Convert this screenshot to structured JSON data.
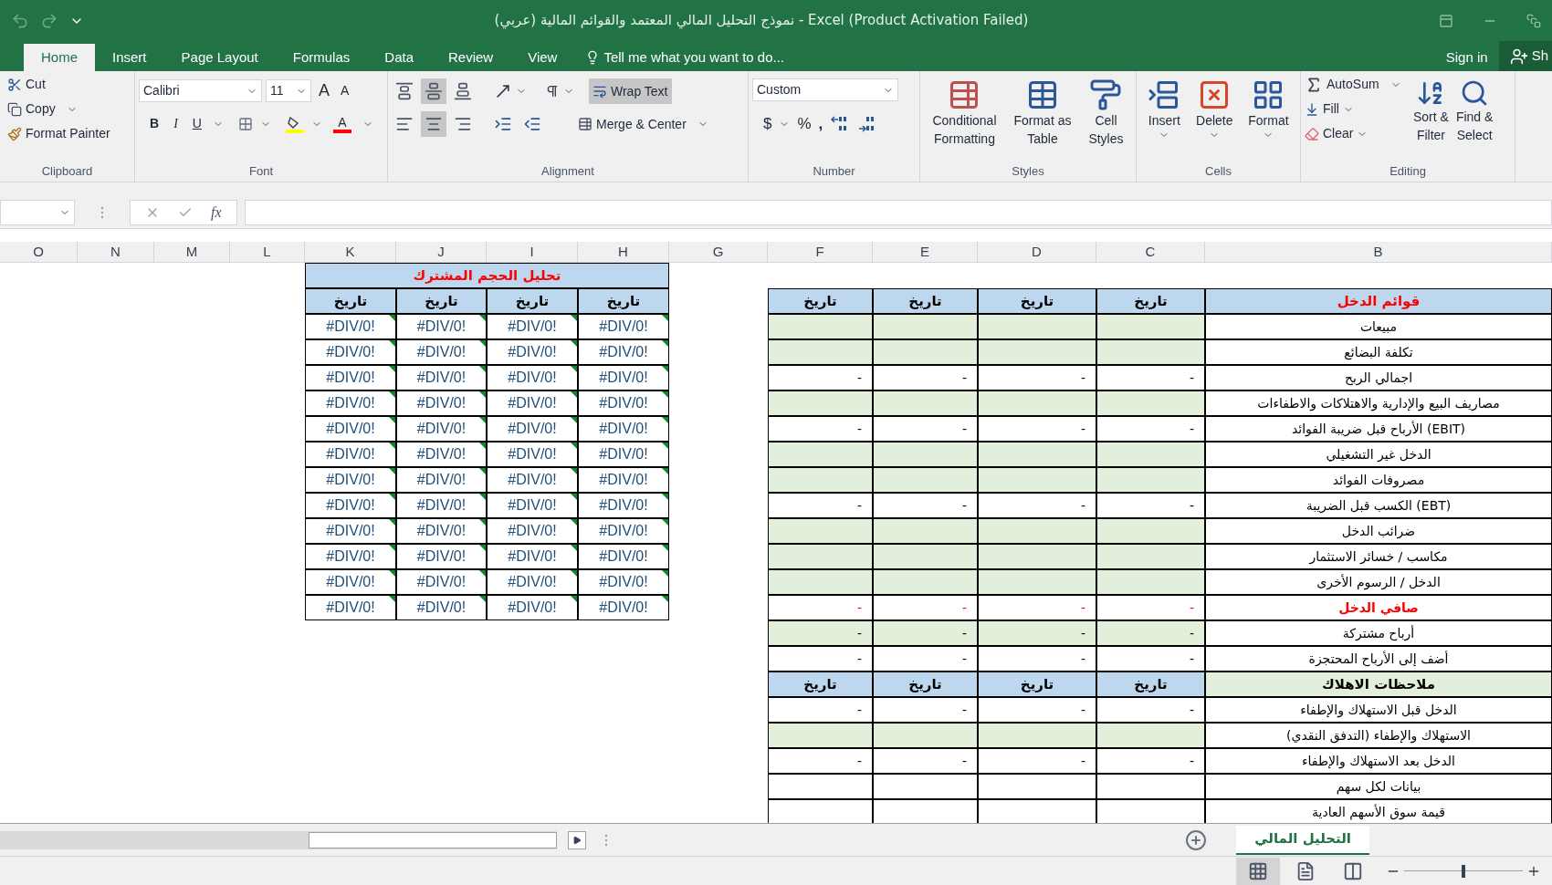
{
  "title_bar": {
    "title": "نموذج التحليل المالي المعتمد والقوائم المالية (عربي) - Excel (Product Activation Failed)"
  },
  "ribbon_tabs": [
    {
      "label": "Home",
      "selected": true
    },
    {
      "label": "Insert",
      "selected": false
    },
    {
      "label": "Page Layout",
      "selected": false
    },
    {
      "label": "Formulas",
      "selected": false
    },
    {
      "label": "Data",
      "selected": false
    },
    {
      "label": "Review",
      "selected": false
    },
    {
      "label": "View",
      "selected": false
    }
  ],
  "tell_me": "Tell me what you want to do...",
  "sign_in": "Sign in",
  "share": "Sh",
  "ribbon": {
    "clipboard": {
      "label": "Clipboard",
      "cut": "Cut",
      "copy": "Copy",
      "format_painter": "Format Painter"
    },
    "font": {
      "label": "Font",
      "font_name": "Calibri",
      "font_size": "11",
      "grow": "A",
      "shrink": "A",
      "bold": "B",
      "italic": "I",
      "underline": "U",
      "font_color": "A"
    },
    "alignment": {
      "label": "Alignment",
      "vertical": [
        {
          "selected": false
        },
        {
          "selected": true
        },
        {
          "selected": false
        }
      ],
      "horizontal": [
        {
          "selected": false
        },
        {
          "selected": true
        },
        {
          "selected": false
        }
      ],
      "wrap_text": {
        "label": "Wrap Text",
        "on": true
      },
      "merge_center": "Merge & Center"
    },
    "number": {
      "label": "Number",
      "format": "Custom",
      "currency": "$",
      "percent": "%",
      "comma": ","
    },
    "styles": {
      "label": "Styles",
      "buttons": [
        {
          "lines": [
            "Conditional",
            "Formatting"
          ]
        },
        {
          "lines": [
            "Format as",
            "Table"
          ]
        },
        {
          "lines": [
            "Cell",
            "Styles"
          ]
        }
      ]
    },
    "cells": {
      "label": "Cells",
      "buttons": [
        "Insert",
        "Delete",
        "Format"
      ]
    },
    "editing": {
      "label": "Editing",
      "autosum": "AutoSum",
      "fill": "Fill",
      "clear": "Clear",
      "buttons": [
        {
          "lines": [
            "Sort &",
            "Filter"
          ]
        },
        {
          "lines": [
            "Find &",
            "Select"
          ]
        }
      ]
    }
  },
  "formula_bar": {
    "function_label": "fx"
  },
  "columns": [
    "O",
    "N",
    "M",
    "L",
    "K",
    "J",
    "I",
    "H",
    "G",
    "F",
    "E",
    "D",
    "C",
    "B"
  ],
  "cvp_table": {
    "title": "تحليل الحجم المشترك",
    "dates": [
      "تاريخ",
      "تاريخ",
      "تاريخ",
      "تاريخ"
    ],
    "rows": [
      [
        "#DIV/0!",
        "#DIV/0!",
        "#DIV/0!",
        "#DIV/0!"
      ],
      [
        "#DIV/0!",
        "#DIV/0!",
        "#DIV/0!",
        "#DIV/0!"
      ],
      [
        "#DIV/0!",
        "#DIV/0!",
        "#DIV/0!",
        "#DIV/0!"
      ],
      [
        "#DIV/0!",
        "#DIV/0!",
        "#DIV/0!",
        "#DIV/0!"
      ],
      [
        "#DIV/0!",
        "#DIV/0!",
        "#DIV/0!",
        "#DIV/0!"
      ],
      [
        "#DIV/0!",
        "#DIV/0!",
        "#DIV/0!",
        "#DIV/0!"
      ],
      [
        "#DIV/0!",
        "#DIV/0!",
        "#DIV/0!",
        "#DIV/0!"
      ],
      [
        "#DIV/0!",
        "#DIV/0!",
        "#DIV/0!",
        "#DIV/0!"
      ],
      [
        "#DIV/0!",
        "#DIV/0!",
        "#DIV/0!",
        "#DIV/0!"
      ],
      [
        "#DIV/0!",
        "#DIV/0!",
        "#DIV/0!",
        "#DIV/0!"
      ],
      [
        "#DIV/0!",
        "#DIV/0!",
        "#DIV/0!",
        "#DIV/0!"
      ],
      [
        "#DIV/0!",
        "#DIV/0!",
        "#DIV/0!",
        "#DIV/0!"
      ]
    ]
  },
  "income_sections": [
    {
      "kind": "statement",
      "title": "قوائم الدخل",
      "dates": [
        "تاريخ",
        "تاريخ",
        "تاريخ",
        "تاريخ"
      ],
      "rows": [
        {
          "label": "مبيعات",
          "shaded": true,
          "highlight": false
        },
        {
          "label": "تكلفة البضائع",
          "shaded": true,
          "highlight": false
        },
        {
          "label": "اجمالي الربح",
          "shaded": false,
          "highlight": false,
          "values": [
            "-",
            "-",
            "-",
            "-"
          ]
        },
        {
          "label": "مصاريف البيع والإدارية والاهتلاكات والاطفاءات",
          "shaded": true,
          "highlight": false
        },
        {
          "label": "الأرباح قبل ضريبة الفوائد (EBIT)",
          "shaded": false,
          "highlight": false,
          "values": [
            "-",
            "-",
            "-",
            "-"
          ]
        },
        {
          "label": "الدخل غير التشغيلي",
          "shaded": true,
          "highlight": false
        },
        {
          "label": "مصروفات الفوائد",
          "shaded": true,
          "highlight": false
        },
        {
          "label": "الكسب قبل الضريبة (EBT)",
          "shaded": false,
          "highlight": false,
          "values": [
            "-",
            "-",
            "-",
            "-"
          ]
        },
        {
          "label": "ضرائب الدخل",
          "shaded": true,
          "highlight": false
        },
        {
          "label": "مكاسب / خسائر الاستثمار",
          "shaded": true,
          "highlight": false
        },
        {
          "label": "الدخل / الرسوم الأخرى",
          "shaded": true,
          "highlight": false
        },
        {
          "label": "صافي الدخل",
          "shaded": false,
          "highlight": true,
          "values": [
            "-",
            "-",
            "-",
            "-"
          ]
        },
        {
          "label": "أرباح مشتركة",
          "shaded": true,
          "highlight": false,
          "values": [
            "-",
            "-",
            "-",
            "-"
          ]
        },
        {
          "label": "أضف إلى الأرباح المحتجزة",
          "shaded": false,
          "highlight": false,
          "values": [
            "-",
            "-",
            "-",
            "-"
          ]
        }
      ]
    },
    {
      "kind": "notes",
      "title": "ملاحظات الاهلاك",
      "dates": [
        "تاريخ",
        "تاريخ",
        "تاريخ",
        "تاريخ"
      ],
      "rows": [
        {
          "label": "الدخل قبل الاستهلاك والإطفاء",
          "shaded": false,
          "highlight": false,
          "values": [
            "-",
            "-",
            "-",
            "-"
          ]
        },
        {
          "label": "الاستهلاك والإطفاء (التدفق النقدي)",
          "shaded": true,
          "highlight": false
        },
        {
          "label": "الدخل بعد الاستهلاك والإطفاء",
          "shaded": false,
          "highlight": false,
          "values": [
            "-",
            "-",
            "-",
            "-"
          ]
        },
        {
          "label": "بيانات لكل سهم",
          "shaded": false,
          "highlight": false
        },
        {
          "label": "قيمة سوق الأسهم العادية",
          "shaded": false,
          "highlight": false
        }
      ]
    }
  ],
  "sheet_tabs": [
    {
      "label": "التحليل المالي",
      "selected": true
    }
  ],
  "status_bar": {
    "views": [
      {
        "selected": true
      },
      {
        "selected": false
      },
      {
        "selected": false
      }
    ],
    "zoom": {
      "level": 0.5
    }
  }
}
